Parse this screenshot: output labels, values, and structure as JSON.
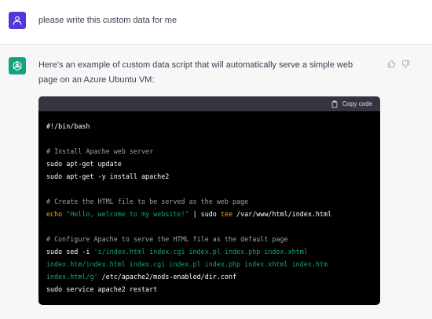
{
  "user_message": {
    "text": "please write this custom data for me",
    "avatar_color": "#5436da",
    "avatar_icon": "person-icon"
  },
  "assistant_message": {
    "avatar_color": "#10a37f",
    "avatar_icon": "openai-logo-icon",
    "intro": "Here's an example of custom data script that will automatically serve a simple web page on an Azure Ubuntu VM:",
    "feedback": {
      "thumbs_up_icon": "thumbs-up-icon",
      "thumbs_down_icon": "thumbs-down-icon"
    },
    "code_block": {
      "copy_label": "Copy code",
      "copy_icon": "clipboard-icon",
      "lines": {
        "shebang": "#!/bin/bash",
        "comment_install": "# Install Apache web server",
        "apt_update": "sudo apt-get update",
        "apt_install": "sudo apt-get -y install apache2",
        "comment_create": "# Create the HTML file to be served as the web page",
        "echo_cmd": "echo",
        "echo_str": "\"Hello, welcome to my website!\"",
        "pipe_sudo": " | sudo ",
        "tee_cmd": "tee",
        "tee_path": " /var/www/html/index.html",
        "comment_configure": "# Configure Apache to serve the HTML file as the default page",
        "sed_cmd": "sudo sed -i ",
        "sed_str_1": "'s/index.html index.cgi index.pl index.php index.xhtml",
        "sed_str_2": "index.htm/index.html index.cgi index.pl index.php index.xhtml index.htm",
        "sed_str_3": "index.html/g'",
        "sed_path": " /etc/apache2/mods-enabled/dir.conf",
        "restart": "sudo service apache2 restart"
      }
    }
  }
}
